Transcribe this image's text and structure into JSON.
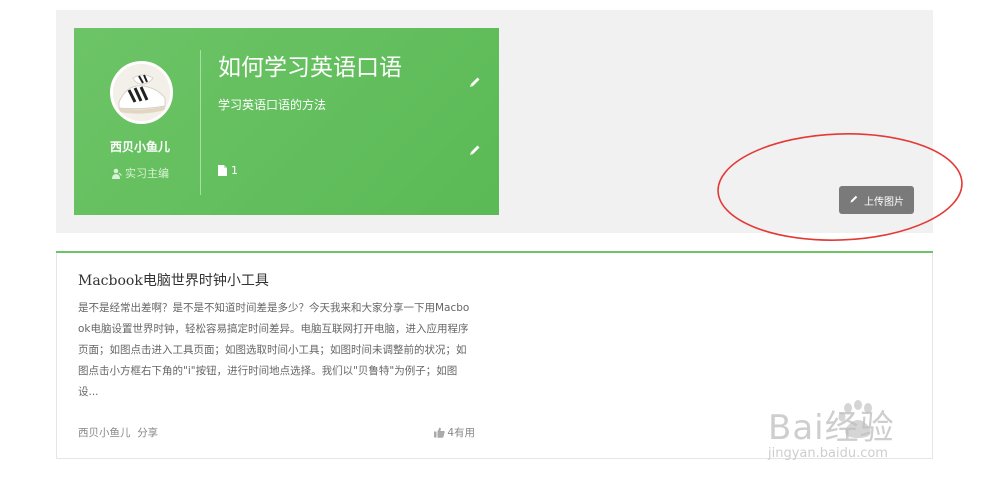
{
  "header": {
    "author_name": "西贝小鱼儿",
    "author_role": "实习主编",
    "title": "如何学习英语口语",
    "subtitle": "学习英语口语的方法",
    "doc_count": "1",
    "upload_label": "上传图片"
  },
  "article": {
    "title": "Macbook电脑世界时钟小工具",
    "excerpt": "是不是经常出差啊？是不是不知道时间差是多少？今天我来和大家分享一下用Macbook电脑设置世界时钟，轻松容易搞定时间差异。电脑互联网打开电脑，进入应用程序页面；如图点击进入工具页面；如图选取时间小工具；如图时间未调整前的状况；如图点击小方框右下角的\"i\"按钮，进行时间地点选择。我们以\"贝鲁特\"为例子；如图设...",
    "author": "西贝小鱼儿",
    "share_label": "分享",
    "likes": "4有用"
  },
  "watermark": {
    "brand": "Bai经验",
    "domain": "jingyan.baidu.com"
  },
  "colors": {
    "card_green": "#64bf5e",
    "upload_gray": "#7a7a7a",
    "annotation_red": "#e53935"
  }
}
